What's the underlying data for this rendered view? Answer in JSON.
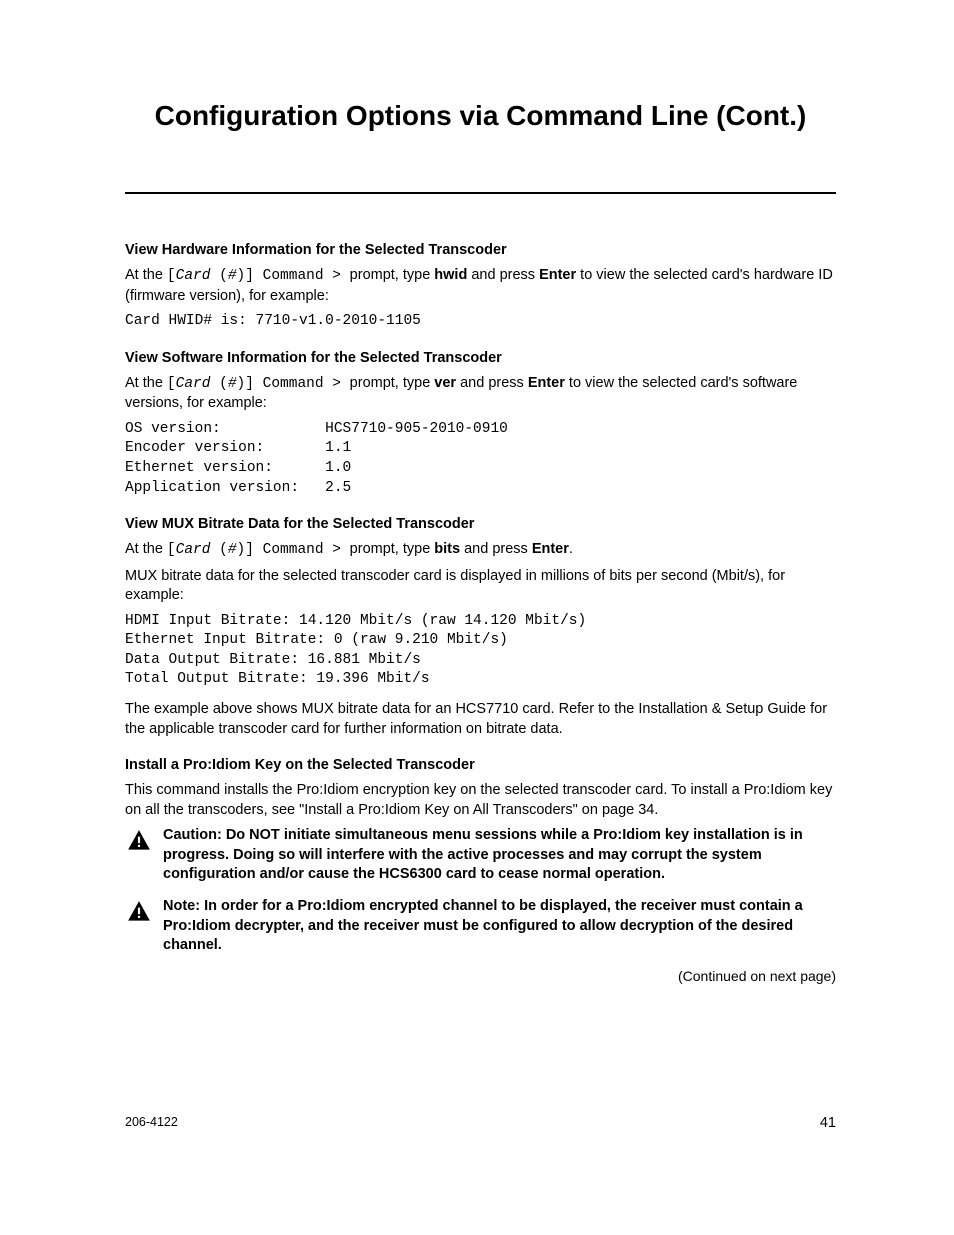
{
  "title": "Configuration Options via Command Line (Cont.)",
  "sections": {
    "hw": {
      "heading": "View Hardware Information for the Selected Transcoder",
      "intro_a": "At the ",
      "prompt_a": "[",
      "prompt_card": "Card",
      "prompt_paren": " (",
      "prompt_hash": "#",
      "prompt_b": ")] Command > ",
      "intro_b": "prompt, type ",
      "cmd": "hwid",
      "intro_c": " and press ",
      "enter": "Enter",
      "intro_d": " to view the selected card's hardware ID (firmware version), for example:",
      "output": "Card HWID# is: 7710-v1.0-2010-1105"
    },
    "sw": {
      "heading": "View Software Information for the Selected Transcoder",
      "intro_b": "prompt, type ",
      "cmd": "ver",
      "intro_c": " and press ",
      "enter": "Enter",
      "intro_d": " to view the selected card's software versions, for example:",
      "output": "OS version:            HCS7710-905-2010-0910\nEncoder version:       1.1\nEthernet version:      1.0\nApplication version:   2.5"
    },
    "mux": {
      "heading": "View MUX Bitrate Data for the Selected Transcoder",
      "intro_b": "prompt, type ",
      "cmd": "bits",
      "intro_c": " and press ",
      "enter": "Enter",
      "intro_d": ".",
      "para": "MUX bitrate data for the selected transcoder card is displayed in millions of bits per second (Mbit/s), for example:",
      "output": "HDMI Input Bitrate: 14.120 Mbit/s (raw 14.120 Mbit/s)\nEthernet Input Bitrate: 0 (raw 9.210 Mbit/s)\nData Output Bitrate: 16.881 Mbit/s\nTotal Output Bitrate: 19.396 Mbit/s",
      "after": "The example above shows MUX bitrate data for an HCS7710 card. Refer to the Installation & Setup Guide for the applicable transcoder card for further information on bitrate data."
    },
    "proidiom": {
      "heading": "Install a Pro:Idiom Key on the Selected Transcoder",
      "para": "This command installs the Pro:Idiom encryption key on the selected transcoder card. To install a Pro:Idiom key on all the transcoders, see \"Install a Pro:Idiom Key on All Transcoders\" on page 34.",
      "caution": "Caution: Do NOT initiate simultaneous menu sessions while a Pro:Idiom key installation is in progress. Doing so will interfere with the active processes and may corrupt the system configuration and/or cause the HCS6300 card to cease normal operation.",
      "note": "Note: In order for a Pro:Idiom encrypted channel to be displayed, the receiver must contain a Pro:Idiom decrypter, and the receiver must be configured to allow decryption of the desired channel."
    }
  },
  "continued": "(Continued on next page)",
  "footer": {
    "doc": "206-4122",
    "page": "41"
  }
}
